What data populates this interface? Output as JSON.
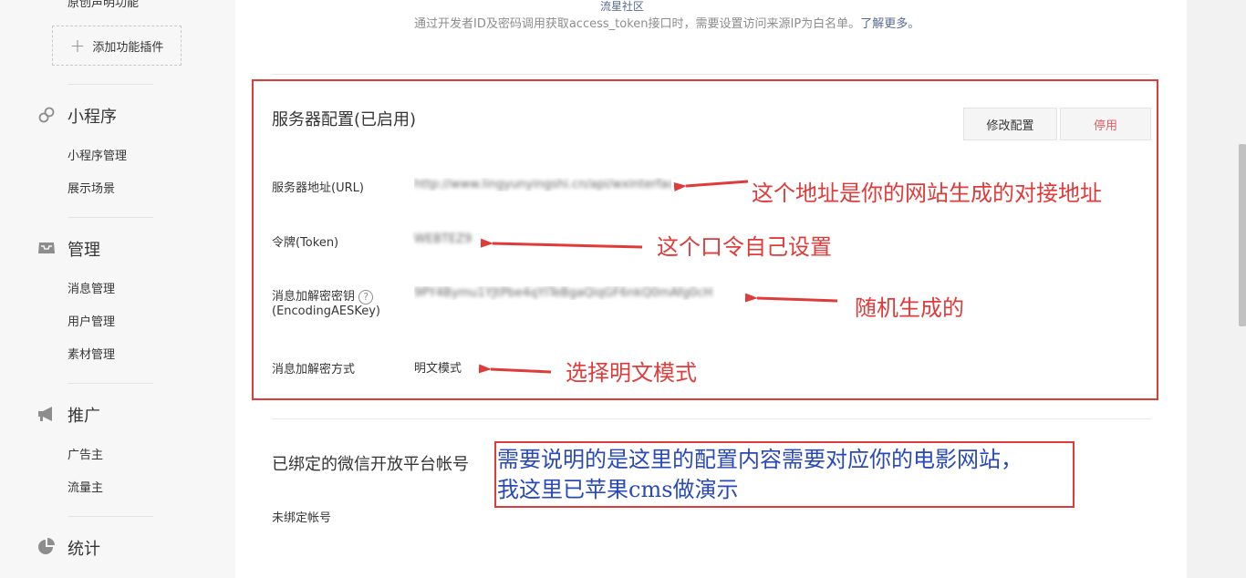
{
  "sidebar": {
    "top_item": "原创声明功能",
    "add_plugin": "添加功能插件",
    "groups": [
      {
        "title": "小程序",
        "icon": "link-icon",
        "items": [
          "小程序管理",
          "展示场景"
        ]
      },
      {
        "title": "管理",
        "icon": "inbox-icon",
        "items": [
          "消息管理",
          "用户管理",
          "素材管理"
        ]
      },
      {
        "title": "推广",
        "icon": "megaphone-icon",
        "items": [
          "广告主",
          "流量主"
        ]
      },
      {
        "title": "统计",
        "icon": "pie-chart-icon",
        "items": []
      }
    ]
  },
  "main": {
    "top_link": "流星社区",
    "notice": "通过开发者ID及密码调用获取access_token接口时，需要设置访问来源IP为白名单。",
    "notice_link": "了解更多。",
    "server_config": {
      "title": "服务器配置(已启用)",
      "modify_button": "修改配置",
      "disable_button": "停用",
      "fields": [
        {
          "label": "服务器地址(URL)",
          "value": "http://www.lingyunyingshi.cn/api/wxinterface.php"
        },
        {
          "label": "令牌(Token)",
          "value": "WEBTEZ9"
        },
        {
          "label": "消息加解密密钥",
          "label2": "(EncodingAESKey)",
          "value": "9PY4Bymu1YJtPbe4qYITeBgaQiqGF6nkQ0mAfg0cH"
        },
        {
          "label": "消息加解密方式",
          "value": "明文模式"
        }
      ]
    },
    "bound_accounts": {
      "title": "已绑定的微信开放平台帐号",
      "status": "未绑定帐号"
    }
  },
  "annotations": {
    "url_note": "这个地址是你的网站生成的对接地址",
    "token_note": "这个口令自己设置",
    "aes_note": "随机生成的",
    "mode_note": "选择明文模式",
    "bottom_note_line1": "需要说明的是这里的配置内容需要对应你的电影网站，",
    "bottom_note_line2": "我这里已苹果cms做演示"
  },
  "colors": {
    "annotation_red": "#e03b3b",
    "annotation_blue": "#2a49b8",
    "link_blue": "#576b95",
    "danger_text": "#e15f63"
  }
}
